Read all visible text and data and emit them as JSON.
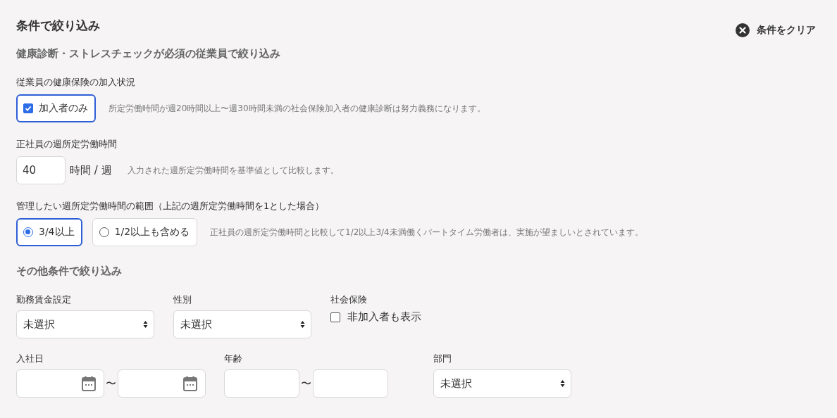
{
  "title": "条件で絞り込み",
  "clear_button": {
    "label": "条件をクリア"
  },
  "health_section": {
    "heading": "健康診断・ストレスチェックが必須の従業員で絞り込み",
    "insurance": {
      "label": "従業員の健康保険の加入状況",
      "option": {
        "label": "加入者のみ",
        "checked": true
      },
      "note": "所定労働時間が週20時間以上〜週30時間未満の社会保険加入者の健康診断は努力義務になります。"
    },
    "hours": {
      "label": "正社員の週所定労働時間",
      "value": "40",
      "unit": "時間 / 週",
      "note": "入力された週所定労働時間を基準値として比較します。"
    },
    "range": {
      "label": "管理したい週所定労働時間の範囲（上記の週所定労働時間を1とした場合）",
      "options": [
        {
          "label": "3/4以上",
          "selected": true
        },
        {
          "label": "1/2以上も含める",
          "selected": false
        }
      ],
      "note": "正社員の週所定労働時間と比較して1/2以上3/4未満働くパートタイム労働者は、実施が望ましいとされています。"
    }
  },
  "other_section": {
    "heading": "その他条件で絞り込み",
    "wage": {
      "label": "勤務賃金設定",
      "value": "未選択"
    },
    "gender": {
      "label": "性別",
      "value": "未選択"
    },
    "social": {
      "label": "社会保険",
      "option": {
        "label": "非加入者も表示",
        "checked": false
      }
    },
    "join_date": {
      "label": "入社日",
      "separator": "〜"
    },
    "age": {
      "label": "年齢",
      "separator": "〜"
    },
    "department": {
      "label": "部門",
      "value": "未選択"
    }
  }
}
